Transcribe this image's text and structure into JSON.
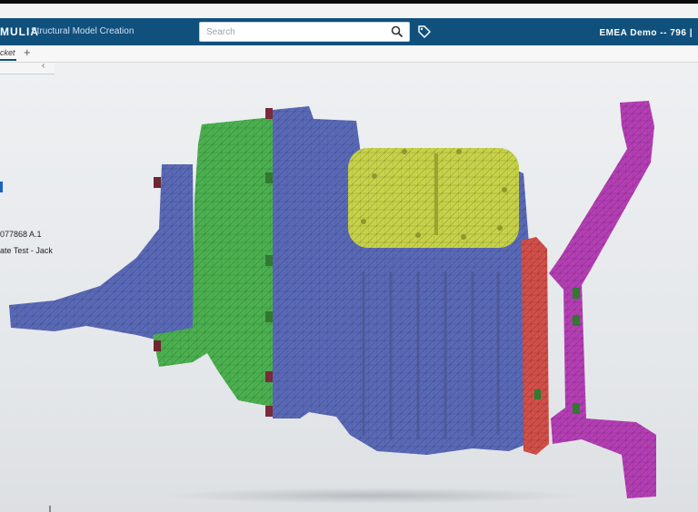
{
  "header": {
    "brand": "MULIA",
    "app_title": "Structural Model Creation",
    "workspace": "EMEA Demo -- 796 |"
  },
  "search": {
    "placeholder": "Search"
  },
  "tabs": [
    {
      "label": "cket"
    }
  ],
  "panel": {
    "collapse_glyph": "‹",
    "part_number": "077868 A.1",
    "part_description": "ate Test - Jack"
  },
  "icons": [
    "search-icon",
    "tag-icon",
    "plus-icon",
    "chevron-left-icon"
  ],
  "colors": {
    "appbar": "#10507d",
    "housing_blue": "#5a69b5",
    "flange_green": "#4caf50",
    "cover_yellow": "#c7d24a",
    "cap_red": "#d2504a",
    "arm_magenta": "#b43fb4"
  }
}
